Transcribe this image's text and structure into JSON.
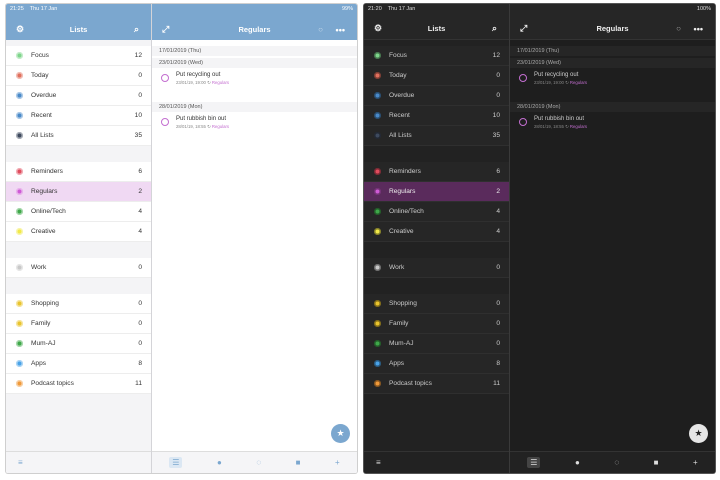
{
  "light": {
    "status": {
      "time": "21:25",
      "date": "Thu 17 Jan",
      "battery": "99%"
    },
    "sidebar_title": "Lists",
    "detail_title": "Regulars",
    "groups": [
      [
        {
          "label": "Focus",
          "count": "12",
          "color": "#7ed58b"
        },
        {
          "label": "Today",
          "count": "0",
          "color": "#e0705e"
        },
        {
          "label": "Overdue",
          "count": "0",
          "color": "#4a8ac9"
        },
        {
          "label": "Recent",
          "count": "10",
          "color": "#4a8ac9"
        },
        {
          "label": "All Lists",
          "count": "35",
          "color": "#3e4a5e"
        }
      ],
      [
        {
          "label": "Reminders",
          "count": "6",
          "color": "#e04c5e"
        },
        {
          "label": "Regulars",
          "count": "2",
          "color": "#cf5bd6",
          "selected": true
        },
        {
          "label": "Online/Tech",
          "count": "4",
          "color": "#3fa84a"
        },
        {
          "label": "Creative",
          "count": "4",
          "color": "#f1e94a"
        }
      ],
      [
        {
          "label": "Work",
          "count": "0",
          "color": "#c9c9c9"
        }
      ],
      [
        {
          "label": "Shopping",
          "count": "0",
          "color": "#e9c42e"
        },
        {
          "label": "Family",
          "count": "0",
          "color": "#e9c42e"
        },
        {
          "label": "Mum-AJ",
          "count": "0",
          "color": "#3fa84a"
        },
        {
          "label": "Apps",
          "count": "8",
          "color": "#4aa3e8"
        },
        {
          "label": "Podcast topics",
          "count": "11",
          "color": "#f09a3a"
        }
      ]
    ],
    "dates": [
      {
        "date": "17/01/2019 (Thu)",
        "tasks": []
      },
      {
        "date": "23/01/2019 (Wed)",
        "tasks": [
          {
            "title": "Put recycling out",
            "meta": "23/01/19, 19:00",
            "list": "Regulars"
          }
        ]
      },
      {
        "date": "28/01/2019 (Mon)",
        "tasks": [
          {
            "title": "Put rubbish bin out",
            "meta": "28/01/19, 18:55",
            "list": "Regulars"
          }
        ]
      }
    ]
  },
  "dark": {
    "status": {
      "time": "21:20",
      "date": "Thu 17 Jan",
      "battery": "100%"
    },
    "sidebar_title": "Lists",
    "detail_title": "Regulars"
  },
  "icons": {
    "settings": "gear-icon",
    "search": "search-icon",
    "expand": "expand-icon",
    "more": "more-icon",
    "star": "star-icon"
  }
}
